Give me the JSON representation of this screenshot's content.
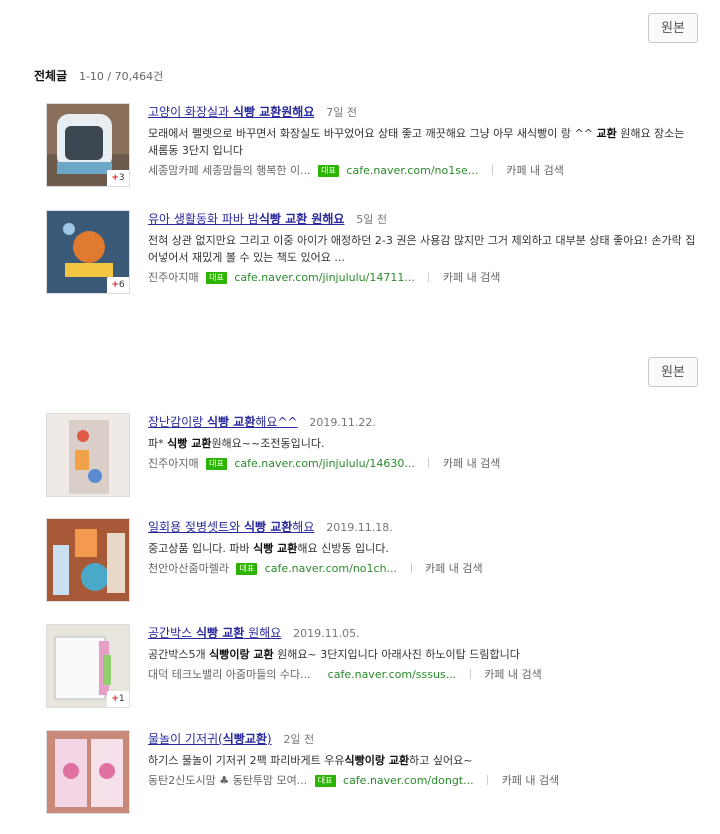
{
  "original_button_label": "원본",
  "header": {
    "title": "전체글",
    "count": "1-10 / 70,464건"
  },
  "group1": [
    {
      "title_parts": [
        "고양이 화장실과 ",
        "식빵 교환원해요"
      ],
      "date": "7일 전",
      "desc_parts": [
        "모래에서 펠렛으로 바꾸면서 화장실도 바꾸었어요 상태 좋고 깨끗해요 그냥 아무 새식빵이 랑 ^^ ",
        "교환",
        " 원해요 장소는 새롬동 3단지 입니다"
      ],
      "source": "세종맘카페 세종맘들의 행복한 이...",
      "tag": "대표",
      "url": "cafe.naver.com/no1se...",
      "in_search": "카페 내 검색",
      "image_count": "3"
    },
    {
      "title_parts": [
        "유아 생활동화 파바 밤",
        "식빵 교환 원해요"
      ],
      "date": "5일 전",
      "desc_parts": [
        "전혀 상관 없지만요 그리고 이중 아이가 애정하던 2-3 권은 사용감 많지만 그거 제외하고 대부분 상태 좋아요! 손가락 집어넣어서 재밌게 볼 수 있는 책도 있어요 ...",
        "",
        ""
      ],
      "source": "진주아지매",
      "tag": "대표",
      "url": "cafe.naver.com/jinjululu/14711...",
      "in_search": "카페 내 검색",
      "image_count": "6"
    }
  ],
  "group2": [
    {
      "title_parts": [
        "장난감이랑 ",
        "식빵 교환",
        "해요^^"
      ],
      "date": "2019.11.22.",
      "desc_parts": [
        "파* ",
        "식빵 교환",
        "원해요~~조전동입니다."
      ],
      "source": "진주아지매",
      "tag": "대표",
      "url": "cafe.naver.com/jinjululu/14630...",
      "in_search": "카페 내 검색",
      "image_count": ""
    },
    {
      "title_parts": [
        "일회용 젖병셋트와 ",
        "식빵 교환",
        "해요"
      ],
      "date": "2019.11.18.",
      "desc_parts": [
        "중고상품 입니다. 파바 ",
        "식빵 교환",
        "해요 신방동 입니다."
      ],
      "source": "천안아산줌마렐라",
      "tag": "대표",
      "url": "cafe.naver.com/no1ch...",
      "in_search": "카페 내 검색",
      "image_count": ""
    },
    {
      "title_parts": [
        "공간박스 ",
        "식빵 교환",
        " 원해요"
      ],
      "date": "2019.11.05.",
      "desc_parts": [
        "공간박스5개 ",
        "식빵이랑 교환",
        " 원해요~ 3단지입니다 아래사진 하노이탑 드림합니다"
      ],
      "source": "대덕 테크노밸리 아줌마들의 수다...",
      "tag": "",
      "url": "cafe.naver.com/sssus...",
      "in_search": "카페 내 검색",
      "image_count": "1"
    },
    {
      "title_parts": [
        "물놀이 기저귀(",
        "식빵교환",
        ")"
      ],
      "date": "2일 전",
      "desc_parts": [
        "하기스 물놀이 기저귀 2팩 파리바게트 우유",
        "식빵이랑 교환",
        "하고 싶어요~"
      ],
      "source": "동탄2신도시맘 ♣ 동탄투맘 모여...",
      "tag": "대표",
      "url": "cafe.naver.com/dongt...",
      "in_search": "카페 내 검색",
      "image_count": ""
    }
  ]
}
